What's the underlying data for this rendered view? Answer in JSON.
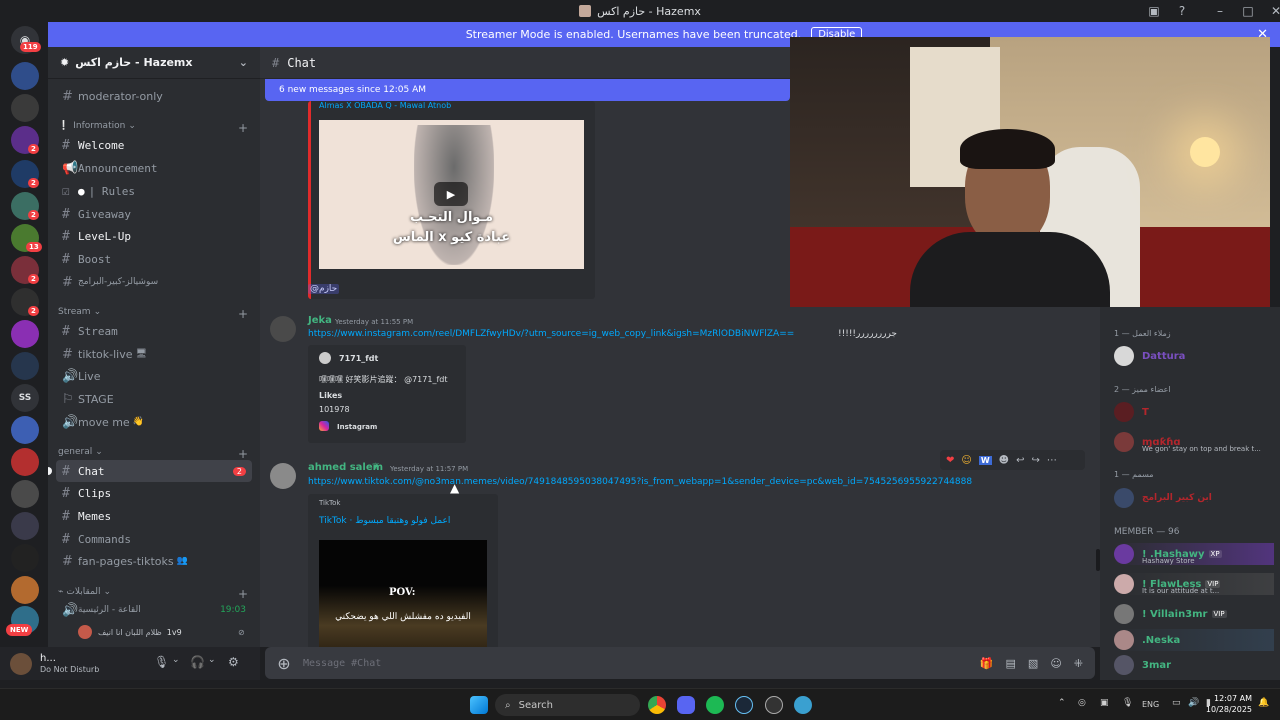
{
  "window": {
    "title": "حازم اكس - Hazemx"
  },
  "banner": {
    "text": "Streamer Mode is enabled. Usernames have been truncated.",
    "button": "Disable"
  },
  "rail": {
    "badges": [
      "119",
      "2",
      "2",
      "2",
      "13",
      "2",
      "2"
    ],
    "server_labels": [
      "SS"
    ],
    "new_label": "NEW"
  },
  "server": {
    "name": "حازم اكس - Hazemx"
  },
  "sidebar": {
    "categories": {
      "information": "Information",
      "stream": "Stream",
      "general": "general",
      "voice": "المقابلات"
    },
    "channels": {
      "moderator": "moderator-only",
      "welcome": "Welcome",
      "announcement": "Announcement",
      "rules": "| Rules",
      "giveaway": "Giveaway",
      "levelup": "LeveL-Up",
      "boost": "Boost",
      "social": "سوشيالز-كبير-البرامج",
      "stream": "Stream",
      "tiktok_live": "tiktok-live",
      "live": "Live",
      "stage": "STAGE",
      "moveme": "move me",
      "chat": "Chat",
      "clips": "Clips",
      "memes": "Memes",
      "commands": "Commands",
      "fanpages": "fan-pages-tiktoks",
      "voice_room": "القاعة - الرئيسية",
      "voice_time": "19:03",
      "voice_user": "ظلام اللبان انا انيف",
      "voice_user_tag": "1v9"
    },
    "chat_badge": "2"
  },
  "user": {
    "name": "h...",
    "status": "Do Not Disturb"
  },
  "chat": {
    "header": "Chat",
    "new_messages": "6 new messages since 12:05 AM",
    "top_embed_title": "Almas X OBADA Q - Mawal Atnob",
    "video_caption_line1": "مـوال التحـب",
    "video_caption_line2": "الماس x عبادة كيو",
    "mention": "@حازم",
    "messages": [
      {
        "author": "Jeka",
        "time": "Yesterday at 11:55 PM",
        "link": "https://www.instagram.com/reel/DMFLZfwyHDv/?utm_source=ig_web_copy_link&igsh=MzRlODBiNWFlZA==",
        "text": "!!!!!جرررررررر",
        "embed": {
          "account": "7171_fdt",
          "line": "嘿嘿嘿 好笑影片追蹤： @7171_fdt",
          "likes_label": "Likes",
          "likes": "101978",
          "provider": "Instagram"
        }
      },
      {
        "author": "ahmed salem",
        "time": "Yesterday at 11:57 PM",
        "link": "https://www.tiktok.com/@no3man.memes/video/7491848595038047495?is_from_webapp=1&sender_device=pc&web_id=7545256955922744888",
        "embed": {
          "provider": "TikTok",
          "title": "TikTok · اعمل فولو وهتبقا مبسوط",
          "pov": "POV:",
          "caption": "الفيديو ده مفشلش اللي هو يضحكني"
        }
      }
    ]
  },
  "composer": {
    "placeholder": "Message #Chat"
  },
  "members": {
    "groups": [
      {
        "title": "زملاء العمل — 1",
        "members": [
          {
            "name": "Dattura",
            "color": "#7a4fc0"
          }
        ]
      },
      {
        "title": "اعضاء مميز — 2",
        "members": [
          {
            "name": "T",
            "color": "#b3262c",
            "sub": ""
          },
          {
            "name": "ɱɑƙɦɑ",
            "color": "#b3262c",
            "sub": "We gon' stay on top and break t..."
          }
        ]
      },
      {
        "title": "مسمم — 1",
        "members": [
          {
            "name": "ابن كبير البرامج",
            "color": "#b3262c"
          }
        ]
      },
      {
        "title": "MEMBER — 96",
        "members": [
          {
            "name": "! .Hashawy",
            "tag": "XP",
            "color": "#43b581",
            "sub": "Hashawy Store"
          },
          {
            "name": "! FlawLess",
            "tag": "VIP",
            "color": "#43b581",
            "sub": "It is our attitude at t..."
          },
          {
            "name": "! Villain3mr",
            "tag": "VIP",
            "color": "#43b581"
          },
          {
            "name": ".Neska",
            "color": "#43b581"
          },
          {
            "name": "3mar",
            "color": "#43b581"
          }
        ]
      }
    ]
  },
  "taskbar": {
    "search": "Search",
    "lang": "ENG",
    "time": "12:07 AM",
    "date": "10/28/2025"
  }
}
